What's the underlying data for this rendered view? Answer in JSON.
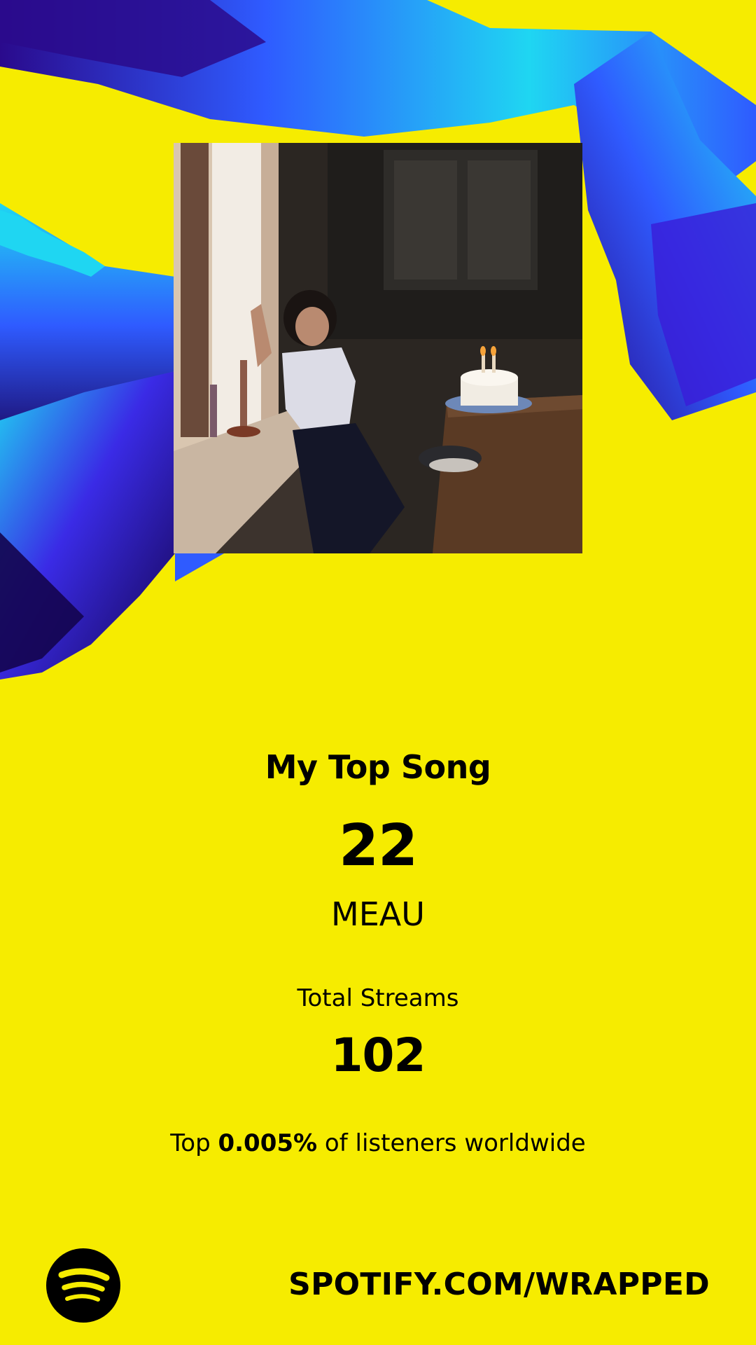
{
  "card": {
    "heading": "My Top Song",
    "song_title": "22",
    "artist": "MEAU",
    "streams_label": "Total Streams",
    "streams_value": "102",
    "percentile_prefix": "Top",
    "percentile_value": "0.005%",
    "percentile_suffix": "of listeners worldwide"
  },
  "footer": {
    "url": "SPOTIFY.COM/WRAPPED",
    "logo_icon": "spotify-logo-icon"
  },
  "colors": {
    "background": "#F6EC00",
    "ribbon_light": "#1FD6F2",
    "ribbon_mid": "#2F5BFF",
    "ribbon_dark": "#2A0A8C",
    "text": "#000000"
  },
  "cover": {
    "image": "album-cover-photo"
  }
}
